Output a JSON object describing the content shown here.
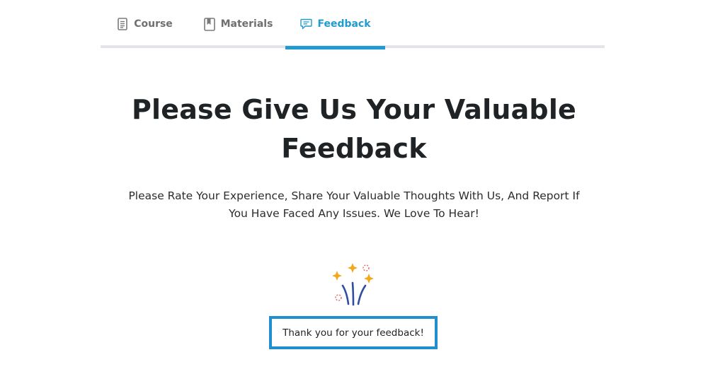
{
  "tabs": {
    "course": {
      "label": "Course",
      "icon": "document-icon"
    },
    "materials": {
      "label": "Materials",
      "icon": "book-icon"
    },
    "feedback": {
      "label": "Feedback",
      "icon": "chat-bubble-icon",
      "active": true
    }
  },
  "colors": {
    "accent": "#1f9bcf",
    "box_border": "#1f8fd0",
    "tab_inactive": "#6f6f6f",
    "heading": "#1f2325",
    "sparkle_gold": "#f2a81d",
    "rocket_blue": "#2f4ea0",
    "firework_red": "#e06b6b"
  },
  "feedback": {
    "heading_line1": "Please Give Us Your Valuable",
    "heading_line2": "Feedback",
    "subtext_line1": "Please Rate Your Experience, Share Your Valuable Thoughts With Us, And Report If",
    "subtext_line2": "You Have Faced Any Issues. We Love To Hear!",
    "celebration_icon": "fireworks-icon",
    "thanks_message": "Thank you for your feedback!"
  }
}
